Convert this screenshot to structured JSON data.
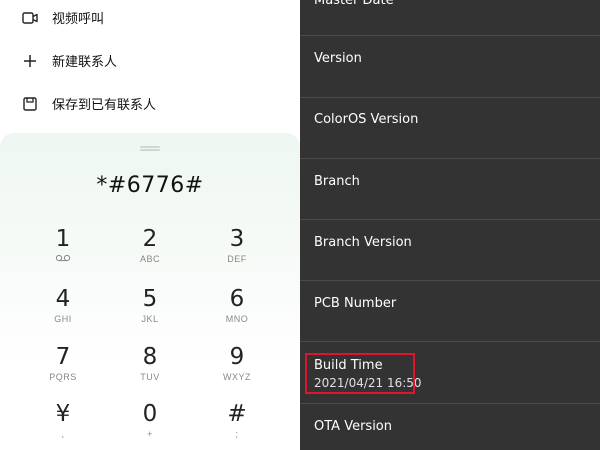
{
  "dialer": {
    "menu": [
      {
        "label": "视频呼叫",
        "icon": "video-call-icon"
      },
      {
        "label": "新建联系人",
        "icon": "plus-icon"
      },
      {
        "label": "保存到已有联系人",
        "icon": "save-icon"
      }
    ],
    "number": "*#6776#",
    "keys": [
      {
        "digit": "1",
        "letters": "voicemail"
      },
      {
        "digit": "2",
        "letters": "ABC"
      },
      {
        "digit": "3",
        "letters": "DEF"
      },
      {
        "digit": "4",
        "letters": "GHI"
      },
      {
        "digit": "5",
        "letters": "JKL"
      },
      {
        "digit": "6",
        "letters": "MNO"
      },
      {
        "digit": "7",
        "letters": "PQRS"
      },
      {
        "digit": "8",
        "letters": "TUV"
      },
      {
        "digit": "9",
        "letters": "WXYZ"
      },
      {
        "digit": "¥",
        "letters": ","
      },
      {
        "digit": "0",
        "letters": "+"
      },
      {
        "digit": "#",
        "letters": ";"
      }
    ]
  },
  "device_info": {
    "rows": [
      {
        "title": "Master Date",
        "value": ""
      },
      {
        "title": "Version",
        "value": ""
      },
      {
        "title": "ColorOS Version",
        "value": ""
      },
      {
        "title": "Branch",
        "value": ""
      },
      {
        "title": "Branch Version",
        "value": ""
      },
      {
        "title": "PCB Number",
        "value": ""
      },
      {
        "title": "Build Time",
        "value": "2021/04/21 16:50"
      },
      {
        "title": "OTA Version",
        "value": ""
      }
    ]
  },
  "colors": {
    "highlight": "#e0142a",
    "panel_dark": "#333333"
  }
}
